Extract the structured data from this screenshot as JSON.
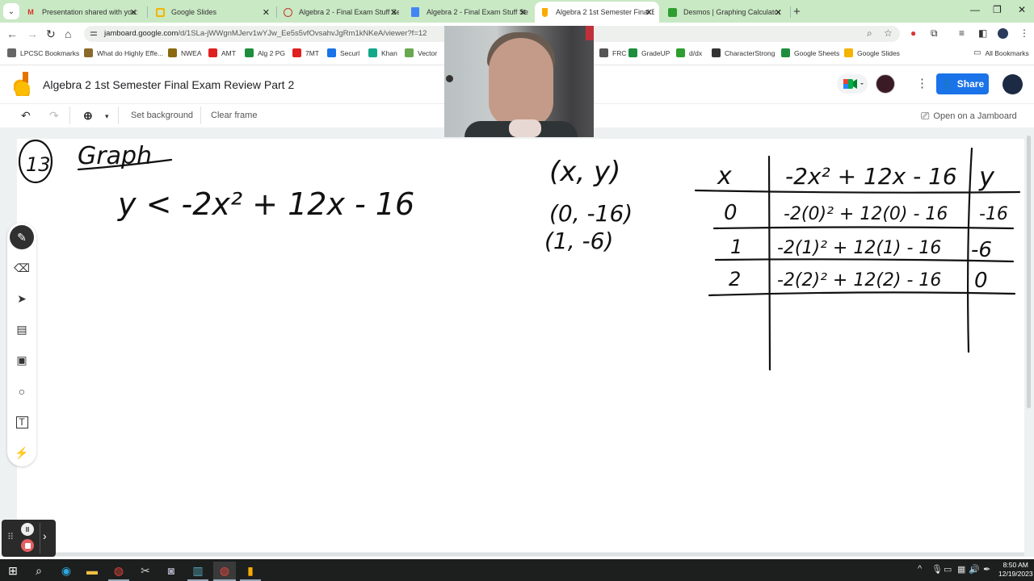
{
  "browser": {
    "tabs": [
      {
        "title": "Presentation shared with you:",
        "icon": "gmail-icon",
        "active": false
      },
      {
        "title": "Google Slides",
        "icon": "google-slides-icon",
        "active": false
      },
      {
        "title": "Algebra 2 - Final Exam Stuff Se",
        "icon": "loading-icon",
        "active": false
      },
      {
        "title": "Algebra 2 - Final Exam Stuff Se",
        "icon": "google-docs-icon",
        "active": false
      },
      {
        "title": "Algebra 2 1st Semester Final E",
        "icon": "jamboard-icon",
        "active": true
      },
      {
        "title": "Desmos | Graphing Calculator",
        "icon": "desmos-icon",
        "active": false
      }
    ],
    "url_host": "jamboard.google.com",
    "url_path": "/d/1SLa-jWWgnMJerv1wYJw_Ee5s5vfOvsahvJgRm1kNKeA/viewer?f=12",
    "bookmarks": [
      {
        "label": "LPCSC Bookmarks",
        "icon": "folder-icon",
        "color": "#666666"
      },
      {
        "label": "What do Highly Effe...",
        "icon": "crown-icon",
        "color": "#8a6a2a"
      },
      {
        "label": "NWEA",
        "icon": "nwea-icon",
        "color": "#8a6a10"
      },
      {
        "label": "AMT",
        "icon": "youtube-icon",
        "color": "#e02020"
      },
      {
        "label": "Alg 2 PG",
        "icon": "sheets-icon",
        "color": "#1e8e3e"
      },
      {
        "label": "7MT",
        "icon": "youtube-icon",
        "color": "#e02020"
      },
      {
        "label": "Securl",
        "icon": "securly-icon",
        "color": "#1a73e8"
      },
      {
        "label": "Khan",
        "icon": "khan-icon",
        "color": "#14a88a"
      },
      {
        "label": "Vector",
        "icon": "vector-icon",
        "color": "#6aa84f"
      },
      {
        "label": "FRC",
        "icon": "frc-icon",
        "color": "#555555"
      },
      {
        "label": "GradeUP",
        "icon": "sheets-icon",
        "color": "#1e8e3e"
      },
      {
        "label": "d/dx",
        "icon": "desmos-icon",
        "color": "#2e9e2e"
      },
      {
        "label": "CharacterStrong",
        "icon": "dumbbell-icon",
        "color": "#333333"
      },
      {
        "label": "Google Sheets",
        "icon": "sheets-icon",
        "color": "#1e8e3e"
      },
      {
        "label": "Google Slides",
        "icon": "google-slides-icon",
        "color": "#f4b400"
      }
    ],
    "all_bookmarks_label": "All Bookmarks"
  },
  "jamboard": {
    "title": "Algebra 2 1st Semester Final Exam Review Part 2",
    "share_label": "Share",
    "toolbar": {
      "set_background": "Set background",
      "clear_frame": "Clear frame",
      "open_on_jamboard": "Open on a Jamboard"
    },
    "tools": [
      "pen-icon",
      "eraser-icon",
      "select-icon",
      "sticky-note-icon",
      "image-icon",
      "shape-icon",
      "text-box-icon",
      "laser-icon"
    ],
    "active_tool": "pen-icon"
  },
  "board": {
    "problem_number": "13",
    "heading": "Graph",
    "inequality": "y < -2x² + 12x - 16",
    "points_header": "(x, y)",
    "points": [
      "(0, -16)",
      "(1, -6)"
    ],
    "table": {
      "headers": [
        "x",
        "-2x² + 12x - 16",
        "y"
      ],
      "rows": [
        {
          "x": "0",
          "work": "-2(0)² + 12(0) - 16",
          "y": "-16"
        },
        {
          "x": "1",
          "work": "-2(1)² + 12(1) - 16",
          "y": "-6"
        },
        {
          "x": "2",
          "work": "-2(2)² + 12(2) - 16",
          "y": "0"
        }
      ]
    }
  },
  "taskbar": {
    "apps": [
      "windows-start-icon",
      "search-icon",
      "edge-icon",
      "file-explorer-icon",
      "chrome-icon",
      "snipping-icon",
      "camera-icon",
      "remote-desktop-icon",
      "chrome-profile-icon",
      "jamboard-icon"
    ],
    "time": "8:50 AM",
    "date": "12/19/2023"
  }
}
